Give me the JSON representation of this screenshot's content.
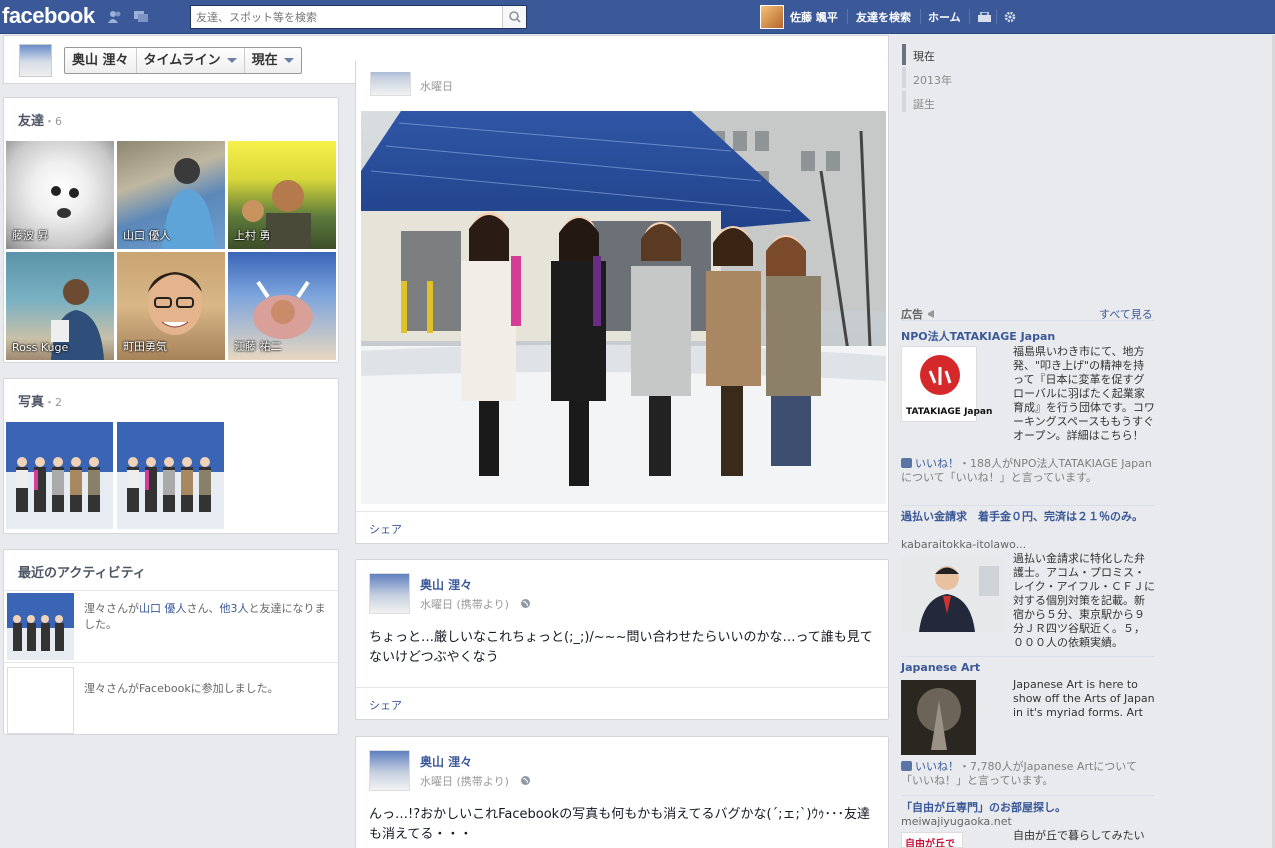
{
  "topbar": {
    "logo": "facebook",
    "search_placeholder": "友達、スポット等を検索",
    "user_name": "佐藤 颯平",
    "nav": [
      "友達を検索",
      "ホーム"
    ]
  },
  "profile_header": {
    "name": "奥山 浬々",
    "timeline": "タイムライン",
    "now": "現在"
  },
  "friends": {
    "title": "友達",
    "count": "・6",
    "list": [
      "藤波 昇",
      "山口 優人",
      "上村 勇",
      "Ross Kuge",
      "町田勇気",
      "江藤 祐二"
    ]
  },
  "photos": {
    "title": "写真",
    "count": "・2"
  },
  "activity": {
    "title": "最近のアクティビティ",
    "item1_pre": "浬々さんが",
    "item1_link1": "山口 優人",
    "item1_mid": "さん、",
    "item1_link2": "他3人",
    "item1_post": "と友達になりました。",
    "item2": "浬々さんがFacebookに参加しました。"
  },
  "feed": {
    "top_meta": "水曜日",
    "share": "シェア",
    "posts": [
      {
        "author": "奥山 浬々",
        "meta": "水曜日 (携帯より)",
        "text": "ちょっと…厳しいなこれちょっと(;_;)/~~~問い合わせたらいいのかな…って誰も見てないけどつぶやくなう"
      },
      {
        "author": "奥山 浬々",
        "meta": "水曜日 (携帯より)",
        "text": "んっ…!?おかしいこれFacebookの写真も何もかも消えてるバグかな(´;ェ;`)ｳｩ･･･友達も消えてる・・・"
      }
    ]
  },
  "scrubber": [
    "現在",
    "2013年",
    "誕生"
  ],
  "ads": {
    "header": "広告",
    "see_all": "すべて見る",
    "items": [
      {
        "title": "NPO法人TATAKIAGE Japan",
        "logo_text": "TATAKIAGE Japan",
        "body": "福島県いわき市にて、地方発、\"叩き上げ\"の精神を持って『日本に変革を促すグローバルに羽ばたく起業家育成』を行う団体です。コワーキングスペースももうすぐオープン。詳細はこちら！",
        "like_label": "いいね！",
        "like_text": "・188人がNPO法人TATAKIAGE Japanについて「いいね！」と言っています。"
      },
      {
        "title": "過払い金請求　着手金０円、完済は２１％のみ。",
        "domain": "kabaraitokka-itolawo...",
        "body": "過払い金請求に特化した弁護士。アコム・プロミス・レイク・アイフル・ＣＦＪに対する個別対策を記載。新宿から５分、東京駅から９分ＪＲ四ツ谷駅近く。５，０００人の依頼実績。"
      },
      {
        "title": "Japanese Art",
        "body": "Japanese Art is here to show off the Arts of Japan in it's myriad forms. Art",
        "like_label": "いいね！",
        "like_text": "・7,780人がJapanese Artについて「いいね！」と言っています。"
      },
      {
        "title": "「自由が丘専門」のお部屋探し。",
        "domain": "meiwajiyugaoka.net",
        "body": "自由が丘で暮らしてみたい",
        "logo_text": "自由が丘で"
      }
    ]
  },
  "colors": {
    "brand_blue": "#3b5998",
    "page_bg": "#e9eaed"
  }
}
